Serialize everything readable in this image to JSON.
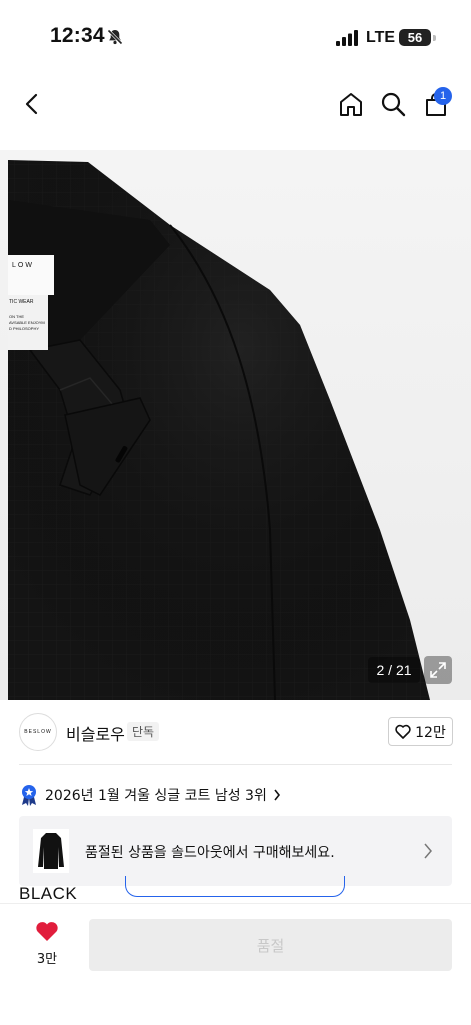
{
  "status_bar": {
    "time": "12:34",
    "network": "LTE",
    "battery": "56"
  },
  "nav": {
    "cart_count": "1",
    "icons": [
      "back-arrow-icon",
      "home-icon",
      "search-icon",
      "cart-icon"
    ]
  },
  "gallery": {
    "counter": "2 / 21",
    "label_lines": [
      "LOW",
      "TIC WEAR",
      "ON THE",
      "AVSABLE ENJOYM",
      "D PHILOSOPHY"
    ]
  },
  "brand": {
    "logo_text": "BESLOW",
    "name": "비슬로우",
    "tag": "단독",
    "likes": "12만"
  },
  "ranking": {
    "text": "2026년 1월 겨울 싱글 코트 남성 3위",
    "badge_color": "#2563eb"
  },
  "soldout_banner": {
    "text": "품절된 상품을 솔드아웃에서 구매해보세요."
  },
  "color_option": {
    "label": "BLACK"
  },
  "bottom": {
    "wish_count": "3만",
    "button_label": "품절",
    "heart_color": "#e11d3c"
  }
}
